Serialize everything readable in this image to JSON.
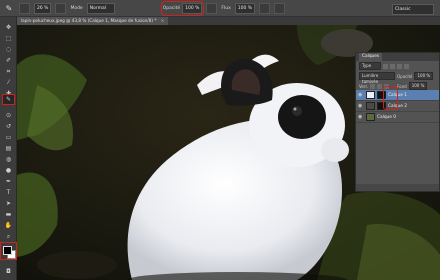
{
  "options_bar": {
    "mode_label": "Mode",
    "mode_value": "Normal",
    "opacity_label": "Opacité",
    "opacity_value": "100 %",
    "flow_label": "Flux",
    "flow_value": "100 %",
    "size_value": "26 %",
    "workspace_value": "Classic"
  },
  "document": {
    "tab_title": "lapin-pelucheux.jpeg @ 43,8 % (Calque 1, Masque de fusion/8) *",
    "close_label": "×"
  },
  "toolbar": {
    "tools": [
      "move-tool",
      "marquee-tool",
      "lasso-tool",
      "quick-select-tool",
      "crop-tool",
      "eyedropper-tool",
      "healing-tool",
      "brush-tool",
      "clone-tool",
      "history-brush-tool",
      "eraser-tool",
      "gradient-tool",
      "blur-tool",
      "dodge-tool",
      "pen-tool",
      "text-tool",
      "path-select-tool",
      "shape-tool",
      "hand-tool",
      "zoom-tool"
    ],
    "selected_tool": "brush-tool",
    "foreground_color": "#000000",
    "background_color": "#ffffff"
  },
  "layers_panel": {
    "tab_label": "Calques",
    "filter_value": "Type",
    "blend_value": "Lumière tamisée",
    "opacity_label": "Opacité",
    "opacity_value": "100 %",
    "lock_label": "Verr.",
    "fill_label": "Fond",
    "fill_value": "100 %",
    "layers": [
      {
        "name": "Calque 1",
        "active": true
      },
      {
        "name": "Calque 2",
        "active": false
      },
      {
        "name": "Calque 0",
        "active": false
      }
    ]
  },
  "colors": {
    "highlight": "#d0221d",
    "ui_dark": "#3c3c3c",
    "panel": "#535353",
    "selection": "#5a7fb0"
  }
}
